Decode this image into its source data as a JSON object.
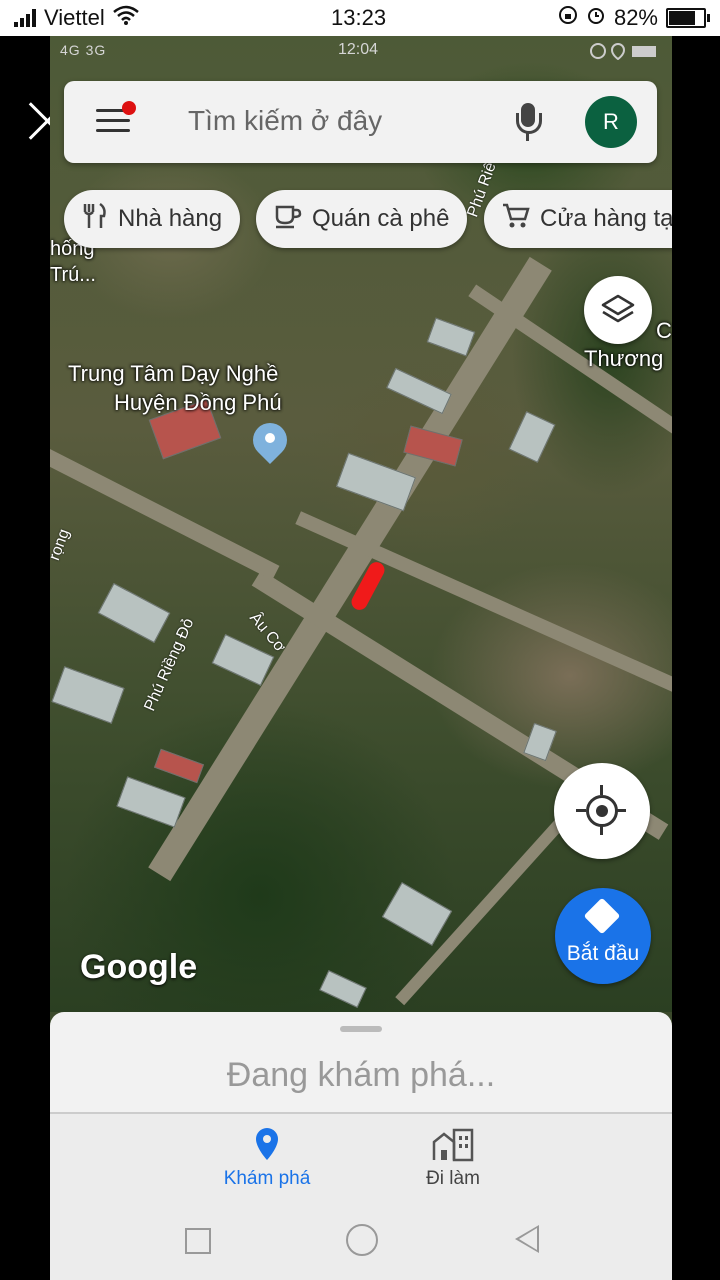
{
  "outer_status": {
    "carrier": "Viettel",
    "time": "13:23",
    "battery": "82%",
    "battery_level": 0.82
  },
  "inner_status": {
    "network": "4G 3G",
    "time": "12:04"
  },
  "search": {
    "placeholder": "Tìm kiếm ở đây",
    "avatar_letter": "R"
  },
  "chips": [
    {
      "label": "Nhà hàng",
      "icon": "fork-knife-icon"
    },
    {
      "label": "Quán cà phê",
      "icon": "coffee-cup-icon"
    },
    {
      "label": "Cửa hàng tạ",
      "icon": "shopping-cart-icon"
    }
  ],
  "map": {
    "place_name_line1": "Trung Tâm Dạy Nghề",
    "place_name_line2": "Huyện Đồng Phú",
    "edge_label_left": "hống\nTrú...",
    "edge_label_right": "Thương",
    "edge_label_right_top": "C",
    "edge_label_top_right": "Phú Riê",
    "roads": {
      "phu_rieng_do": "Phú Riềng Đỏ",
      "au_co": "Âu Cơ",
      "left_road": "rọng"
    },
    "logo": "Google"
  },
  "buttons": {
    "start_label": "Bắt đầu"
  },
  "sheet": {
    "status": "Đang khám phá..."
  },
  "bottom_nav": {
    "explore": "Khám phá",
    "commute": "Đi làm"
  },
  "colors": {
    "accent": "#1a73e8",
    "avatar_bg": "#0b6140",
    "notification_dot": "#d11111",
    "marker": "#f01a1a"
  }
}
